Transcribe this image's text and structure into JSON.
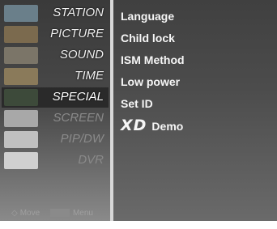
{
  "menu": {
    "items": [
      {
        "label": "STATION",
        "thumb": "#6a7f8a",
        "dim": false,
        "active": false
      },
      {
        "label": "PICTURE",
        "thumb": "#7b6a4e",
        "dim": false,
        "active": false
      },
      {
        "label": "SOUND",
        "thumb": "#7b7568",
        "dim": false,
        "active": false
      },
      {
        "label": "TIME",
        "thumb": "#8a7a5a",
        "dim": false,
        "active": false
      },
      {
        "label": "SPECIAL",
        "thumb": "#3d4a3a",
        "dim": false,
        "active": true
      },
      {
        "label": "SCREEN",
        "thumb": "#a8a8a8",
        "dim": true,
        "active": false
      },
      {
        "label": "PIP/DW",
        "thumb": "#c0c0c0",
        "dim": true,
        "active": false
      },
      {
        "label": "DVR",
        "thumb": "#d0d0d0",
        "dim": true,
        "active": false
      }
    ]
  },
  "submenu": {
    "items": [
      "Language",
      "Child lock",
      "ISM Method",
      "Low power",
      "Set ID",
      "Demo"
    ],
    "xd_logo": "XD"
  },
  "footer": {
    "move_label": "Move",
    "menu_label": "Menu"
  }
}
